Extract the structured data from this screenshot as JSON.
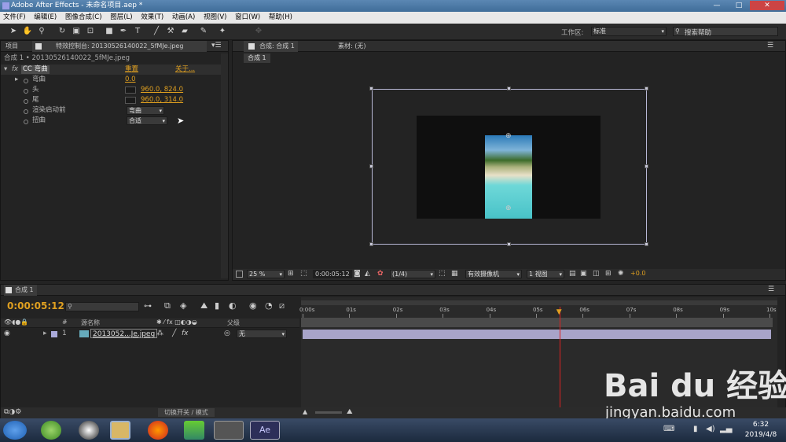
{
  "window": {
    "title": "Adobe After Effects - 未命名项目.aep *"
  },
  "menu": [
    "文件(F)",
    "编辑(E)",
    "图像合成(C)",
    "图层(L)",
    "效果(T)",
    "动画(A)",
    "视图(V)",
    "窗口(W)",
    "帮助(H)"
  ],
  "toolbar": {
    "workspace_label": "工作区:",
    "workspace_value": "标准",
    "search_placeholder": "搜索帮助"
  },
  "effects_panel": {
    "tab_project": "项目",
    "tab_effects": "特效控制台: 20130526140022_5fMJe.jpeg",
    "breadcrumb": "合成 1 • 20130526140022_5fMJe.jpeg",
    "effect_name": "CC 弯曲",
    "reset": "重置",
    "about": "关于...",
    "props": [
      {
        "label": "弯曲",
        "value": "0.0"
      },
      {
        "label": "头",
        "value": "960.0, 824.0"
      },
      {
        "label": "尾",
        "value": "960.0, 314.0"
      },
      {
        "label": "渲染启动前",
        "value": "弯曲"
      },
      {
        "label": "扭曲",
        "value": "合适"
      }
    ]
  },
  "viewer": {
    "tab_comp": "合成: 合成 1",
    "tab_footage": "素材: (无)",
    "comp_tab": "合成 1",
    "zoom": "25 %",
    "timecode": "0:00:05:12",
    "resolution": "(1/4)",
    "camera": "有效摄像机",
    "views": "1 视图",
    "exposure": "+0.0"
  },
  "timeline": {
    "tab": "合成 1",
    "timecode": "0:00:05:12",
    "search_placeholder": "",
    "col_source": "源名称",
    "col_parent": "父级",
    "ruler": [
      "0:00s",
      "01s",
      "02s",
      "03s",
      "04s",
      "05s",
      "06s",
      "07s",
      "08s",
      "09s",
      "10s"
    ],
    "layer": {
      "index": "1",
      "name": "2013052...Je.jpeg",
      "parent": "无"
    },
    "toggle_label": "切换开关 / 模式",
    "playhead_fraction": 0.55
  },
  "taskbar": {
    "time": "6:32",
    "date": "2019/4/8"
  },
  "watermark": {
    "brand": "Bai du 经验",
    "url": "jingyan.baidu.com"
  }
}
